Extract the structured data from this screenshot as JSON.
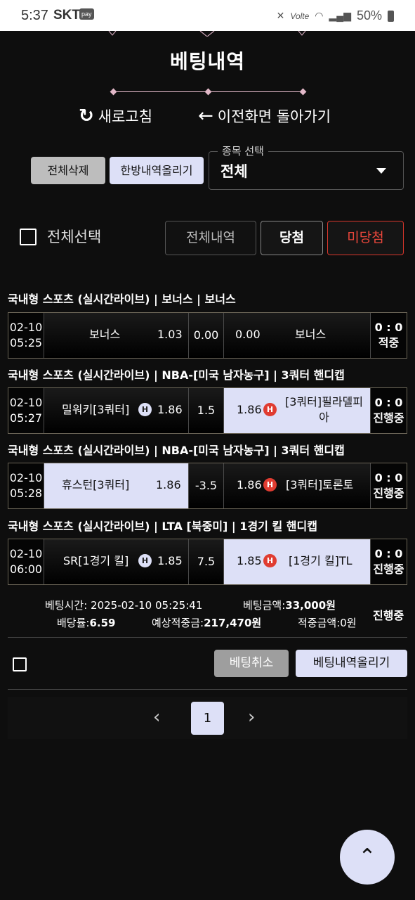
{
  "status_bar": {
    "time": "5:37",
    "carrier": "SKT",
    "pay_badge": "pay",
    "volte": "Volte",
    "battery": "50%"
  },
  "page": {
    "title": "베팅내역",
    "refresh_label": "새로고침",
    "back_label": "이전화면 돌아가기",
    "delete_all_label": "전체삭제",
    "upload_all_label": "한방내역올리기",
    "sport_select": {
      "label": "종목 선택",
      "value": "전체"
    },
    "select_all_label": "전체선택",
    "filters": {
      "all": "전체내역",
      "win": "당첨",
      "lose": "미당첨"
    }
  },
  "bets": [
    {
      "category": "국내형 스포츠 (실시간라이브) | 보너스 | 보너스",
      "date": "02-10",
      "time": "05:25",
      "home": "보너스",
      "home_odds": "1.03",
      "mid": "0.00",
      "away_odds": "0.00",
      "away": "보너스",
      "score": "0 : 0",
      "status": "적중"
    },
    {
      "category": "국내형 스포츠 (실시간라이브) | NBA-[미국 남자농구] | 3쿼터 핸디캡",
      "date": "02-10",
      "time": "05:27",
      "home": "밀워키[3쿼터]",
      "home_badge": "H",
      "home_odds": "1.86",
      "mid": "1.5",
      "away_odds": "1.86",
      "away_badge": "H",
      "away_line1": "[3쿼터]필라델피",
      "away_line2": "아",
      "score": "0 : 0",
      "status": "진행중"
    },
    {
      "category": "국내형 스포츠 (실시간라이브) | NBA-[미국 남자농구] | 3쿼터 핸디캡",
      "date": "02-10",
      "time": "05:28",
      "home": "휴스턴[3쿼터]",
      "home_odds": "1.86",
      "mid": "-3.5",
      "away_odds": "1.86",
      "away_badge": "H",
      "away": "[3쿼터]토론토",
      "score": "0 : 0",
      "status": "진행중"
    },
    {
      "category": "국내형 스포츠 (실시간라이브) | LTA [북중미] | 1경기 킬 핸디캡",
      "date": "02-10",
      "time": "06:00",
      "home": "SR[1경기 킬]",
      "home_badge": "H",
      "home_odds": "1.85",
      "mid": "7.5",
      "away_odds": "1.85",
      "away_badge": "H",
      "away": "[1경기 킬]TL",
      "score": "0 : 0",
      "status": "진행중"
    }
  ],
  "summary": {
    "bet_time_label": "베팅시간:",
    "bet_time": "2025-02-10 05:25:41",
    "bet_amount_label": "베팅금액:",
    "bet_amount": "33,000원",
    "odds_label": "배당률:",
    "odds": "6.59",
    "expected_label": "예상적중금:",
    "expected": "217,470원",
    "won_label": "적중금액:",
    "won": "0원",
    "status": "진행중"
  },
  "actions": {
    "cancel_label": "베팅취소",
    "upload_label": "베팅내역올리기"
  },
  "pagination": {
    "prev": "‹",
    "current": "1",
    "next": "›"
  },
  "fab_icon": "chevron-up-icon"
}
